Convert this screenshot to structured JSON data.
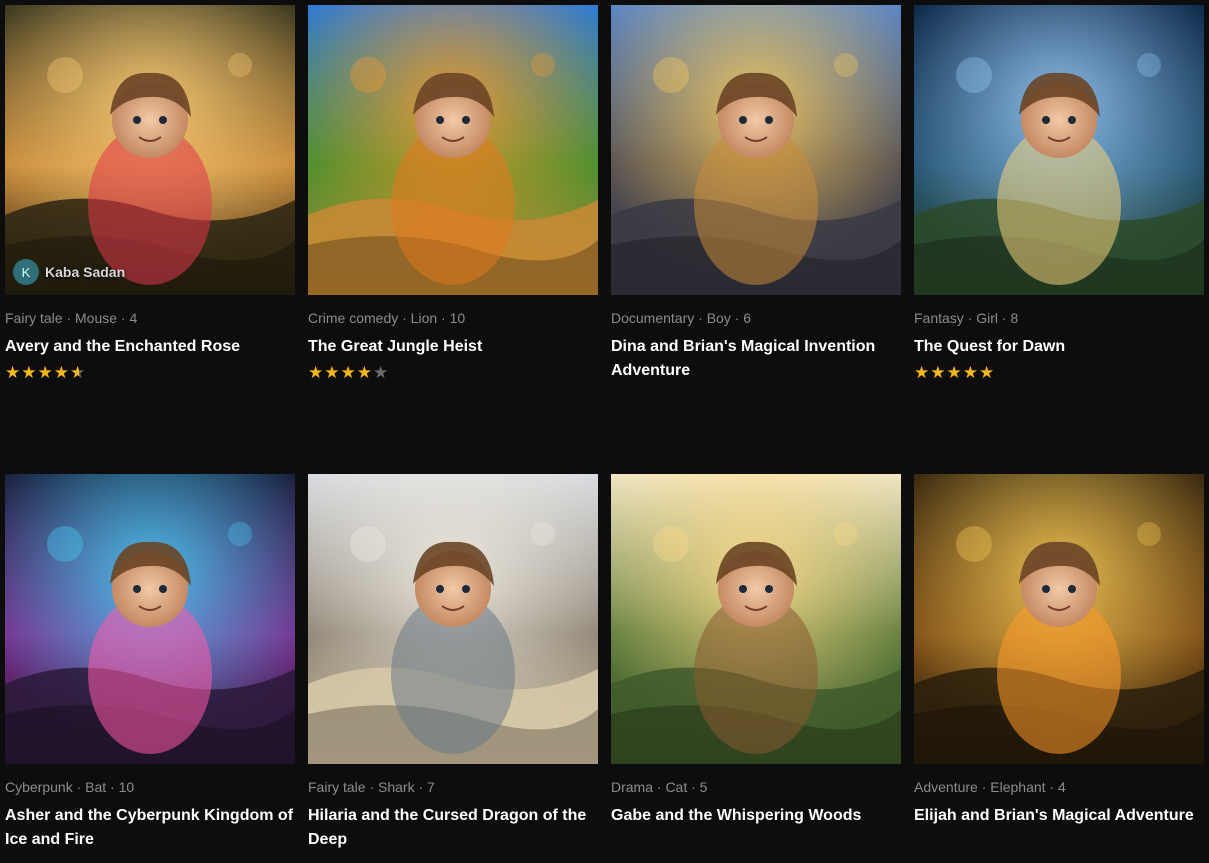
{
  "stories": [
    {
      "meta": "Fairy tale · Mouse · 4",
      "title": "Avery and the Enchanted Rose",
      "rating": 4.5,
      "author": {
        "initial": "K",
        "name": "Kaba Sadan"
      },
      "palette": {
        "sky": "#3a3820",
        "mid": "#c78a3a",
        "glow": "#ffd27a",
        "ground": "#2a2412",
        "accent": "#e0364a"
      },
      "scene": "girl-with-mouse-and-rose"
    },
    {
      "meta": "Crime comedy · Lion · 10",
      "title": "The Great Jungle Heist",
      "rating": 4,
      "palette": {
        "sky": "#2e7bd6",
        "mid": "#3f8f2e",
        "glow": "#ff9a2a",
        "ground": "#c98a35",
        "accent": "#e0781d"
      },
      "scene": "fox-and-lion-jungle"
    },
    {
      "meta": "Documentary · Boy · 6",
      "title": "Dina and Brian's Magical Invention Adventure",
      "rating": null,
      "palette": {
        "sky": "#5b86c6",
        "mid": "#4d4a52",
        "glow": "#ffcf5a",
        "ground": "#3a3a44",
        "accent": "#c78a3a"
      },
      "scene": "boy-village-glowing-hands"
    },
    {
      "meta": "Fantasy · Girl · 8",
      "title": "The Quest for Dawn",
      "rating": 5,
      "palette": {
        "sky": "#0f2a4a",
        "mid": "#1f4d6a",
        "glow": "#9fd0ff",
        "ground": "#2b4a2a",
        "accent": "#f3d27a"
      },
      "scene": "forest-rune-stone"
    },
    {
      "meta": "Cyberpunk · Bat · 10",
      "title": "Asher and the Cyberpunk Kingdom of Ice and Fire",
      "rating": null,
      "palette": {
        "sky": "#1a2240",
        "mid": "#7a2a8a",
        "glow": "#4ad8ff",
        "ground": "#2a1a38",
        "accent": "#ff5aa8"
      },
      "scene": "boy-neon-city-bat"
    },
    {
      "meta": "Fairy tale · Shark · 7",
      "title": "Hilaria and the Cursed Dragon of the Deep",
      "rating": null,
      "palette": {
        "sky": "#d9dce0",
        "mid": "#8a8070",
        "glow": "#f4efe4",
        "ground": "#d8c9a8",
        "accent": "#6a7a86"
      },
      "scene": "girl-holding-shark-beach"
    },
    {
      "meta": "Drama · Cat · 5",
      "title": "Gabe and the Whispering Woods",
      "rating": null,
      "palette": {
        "sky": "#f2e6c4",
        "mid": "#5a7a3a",
        "glow": "#ffdc8a",
        "ground": "#3f5a2a",
        "accent": "#8a5a30"
      },
      "scene": "boy-village-valley"
    },
    {
      "meta": "Adventure · Elephant · 4",
      "title": "Elijah and Brian's Magical Adventure",
      "rating": null,
      "palette": {
        "sky": "#3a2a10",
        "mid": "#7a4a14",
        "glow": "#ffd25a",
        "ground": "#2a1e0c",
        "accent": "#ff9a2a"
      },
      "scene": "boy-elephant-golden-forest"
    }
  ]
}
